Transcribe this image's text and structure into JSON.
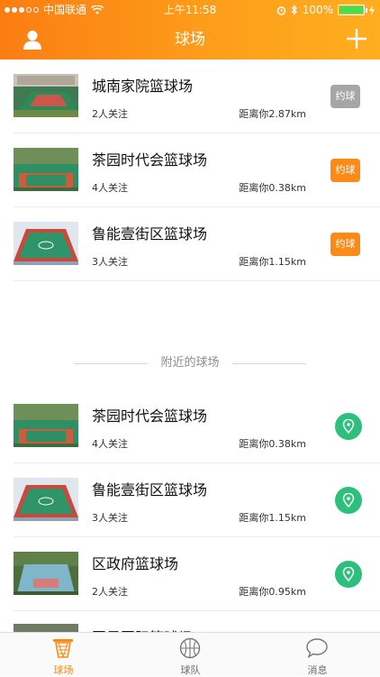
{
  "status_bar": {
    "carrier": "中国联通",
    "time": "上午11:58",
    "battery": "100%"
  },
  "nav": {
    "title": "球场"
  },
  "booking_courts": [
    {
      "name": "城南家院篮球场",
      "followers": "2人关注",
      "distance": "距离你2.87km",
      "action": "约球",
      "action_state": "disabled"
    },
    {
      "name": "茶园时代会篮球场",
      "followers": "4人关注",
      "distance": "距离你0.38km",
      "action": "约球",
      "action_state": "active"
    },
    {
      "name": "鲁能壹街区篮球场",
      "followers": "3人关注",
      "distance": "距离你1.15km",
      "action": "约球",
      "action_state": "active"
    }
  ],
  "nearby_section": {
    "title": "附近的球场"
  },
  "nearby_courts": [
    {
      "name": "茶园时代会篮球场",
      "followers": "4人关注",
      "distance": "距离你0.38km"
    },
    {
      "name": "鲁能壹街区篮球场",
      "followers": "3人关注",
      "distance": "距离你1.15km"
    },
    {
      "name": "区政府篮球场",
      "followers": "2人关注",
      "distance": "距离你0.95km"
    },
    {
      "name": "国景国际篮球场"
    }
  ],
  "tabs": [
    {
      "label": "球场",
      "icon": "basketball-hoop-icon",
      "active": true
    },
    {
      "label": "球队",
      "icon": "basketball-icon",
      "active": false
    },
    {
      "label": "消息",
      "icon": "chat-bubble-icon",
      "active": false
    }
  ],
  "colors": {
    "accent": "#fb8a17",
    "header_gradient_start": "#fb7d12",
    "header_gradient_end": "#ffae1f",
    "disabled_button": "#a6a6a6",
    "map_pin": "#2dbf7c",
    "battery": "#3fe05a"
  }
}
